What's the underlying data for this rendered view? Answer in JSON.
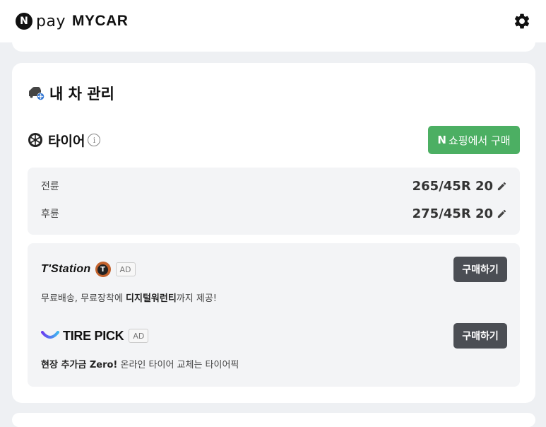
{
  "header": {
    "logo_letter": "N",
    "pay": "pay",
    "mycar": "MYCAR"
  },
  "section": {
    "title": "내 차 관리"
  },
  "tire": {
    "title": "타이어",
    "info": "i",
    "shop_button": {
      "n": "N",
      "label": "쇼핑에서 구매"
    },
    "sizes": [
      {
        "label": "전륜",
        "value": "265/45R 20"
      },
      {
        "label": "후륜",
        "value": "275/45R 20"
      }
    ]
  },
  "ads": [
    {
      "brand": "T'Station",
      "badge_letter": "T",
      "ad_tag": "AD",
      "button": "구매하기",
      "desc_prefix": "무료배송, 무료장착에 ",
      "desc_bold": "디지털워런티",
      "desc_suffix": "까지 제공!"
    },
    {
      "brand": "TIRE PICK",
      "ad_tag": "AD",
      "button": "구매하기",
      "desc_bold": "현장 추가금 Zero!",
      "desc_suffix": " 온라인 타이어 교체는 타이어픽"
    }
  ],
  "colors": {
    "shop_green": "#4caf63",
    "buy_dark": "#4b4e54",
    "car_icon_blue": "#3a7bd5"
  }
}
